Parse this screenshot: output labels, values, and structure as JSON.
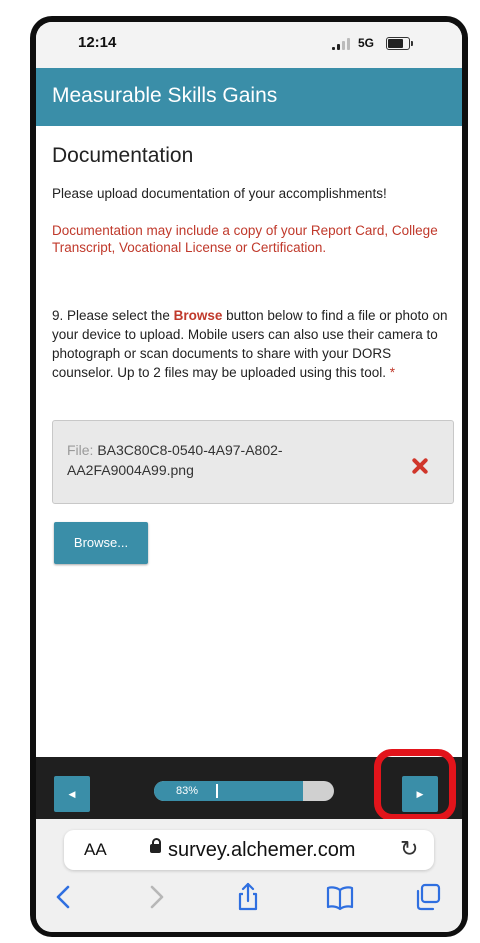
{
  "status_bar": {
    "time": "12:14",
    "network": "5G"
  },
  "header": {
    "title": "Measurable Skills Gains"
  },
  "page": {
    "section_title": "Documentation",
    "intro": "Please upload documentation of your accomplishments!",
    "note": "Documentation may include a copy of your Report Card, College Transcript, Vocational License or Certification.",
    "question": {
      "prefix": "9. Please select the ",
      "highlight": "Browse",
      "suffix": " button below to find a file or photo on your device to upload. Mobile users can also use their camera to photograph or scan documents to share with your DORS counselor. Up to 2 files may be uploaded using this tool.",
      "required_mark": "*"
    },
    "file": {
      "prefix": "File:",
      "name": "BA3C80C8-0540-4A97-A802-AA2FA9004A99.png"
    },
    "browse_label": "Browse..."
  },
  "nav": {
    "progress_text": "83%",
    "progress": 0.83
  },
  "browser": {
    "aa_label": "AA",
    "domain": "survey.alchemer.com"
  },
  "colors": {
    "accent": "#3a8ea8",
    "alert": "#c0392b",
    "highlight_ring": "#e2141b"
  }
}
